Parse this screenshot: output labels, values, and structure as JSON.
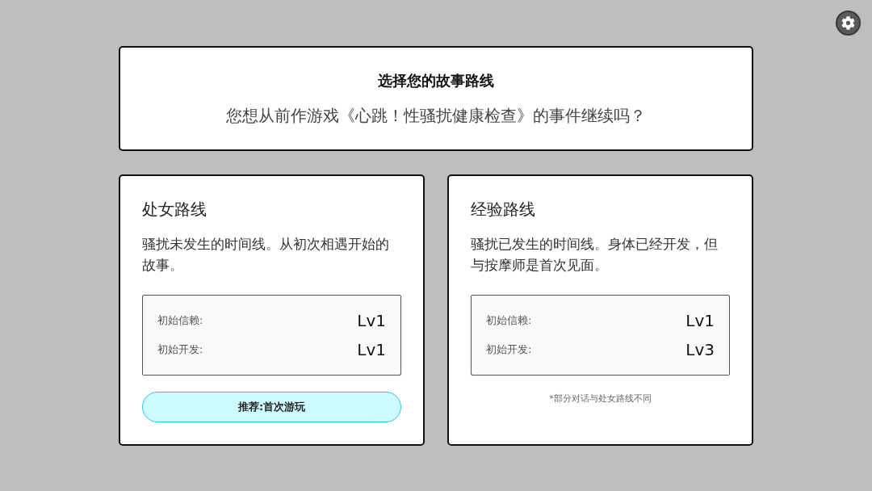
{
  "header": {
    "title": "选择您的故事路线",
    "question": "您想从前作游戏《心跳！性骚扰健康检查》的事件继续吗？"
  },
  "routes": [
    {
      "title": "处女路线",
      "description": "骚扰未发生的时间线。从初次相遇开始的故事。",
      "stats": [
        {
          "label": "初始信赖:",
          "value": "Lv1"
        },
        {
          "label": "初始开发:",
          "value": "Lv1"
        }
      ],
      "footer": {
        "kind": "button",
        "text": "推荐:首次游玩"
      }
    },
    {
      "title": "经验路线",
      "description": "骚扰已发生的时间线。身体已经开发，但与按摩师是首次见面。",
      "stats": [
        {
          "label": "初始信赖:",
          "value": "Lv1"
        },
        {
          "label": "初始开发:",
          "value": "Lv3"
        }
      ],
      "footer": {
        "kind": "note",
        "text": "*部分对话与处女路线不同"
      }
    }
  ]
}
